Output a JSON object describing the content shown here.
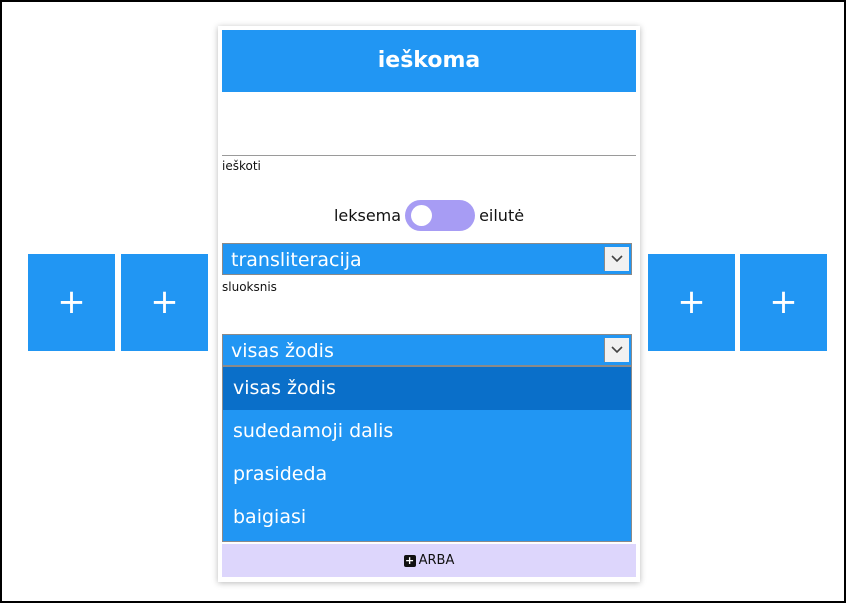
{
  "left_buttons": [
    "+",
    "+"
  ],
  "right_buttons": [
    "+",
    "+"
  ],
  "card": {
    "title": "ieškoma",
    "search": {
      "value": "",
      "label": "ieškoti"
    },
    "toggle": {
      "left_label": "leksema",
      "right_label": "eilutė",
      "state": "left",
      "color": "#a79cf4"
    },
    "layer_select": {
      "value": "transliteracija",
      "label": "sluoksnis"
    },
    "match_select": {
      "value": "visas žodis",
      "options": [
        "visas žodis",
        "sudedamoji dalis",
        "prasideda",
        "baigiasi"
      ],
      "highlighted": "visas žodis"
    },
    "or_button": {
      "label": "ARBA",
      "icon": "plus-square-icon"
    }
  },
  "colors": {
    "accent": "#2196F3",
    "highlight": "#0a6fc9",
    "footer": "#ddd6fc"
  }
}
